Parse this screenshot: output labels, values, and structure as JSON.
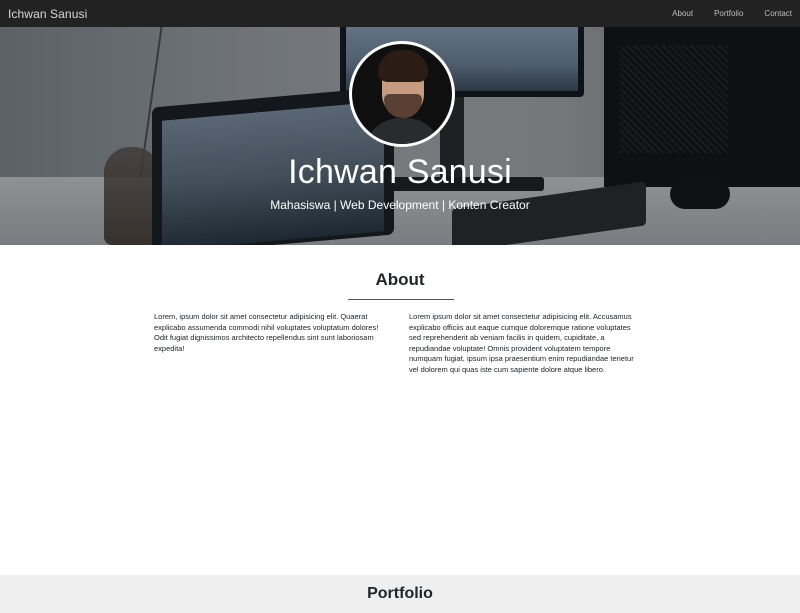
{
  "navbar": {
    "brand": "Ichwan Sanusi",
    "links": [
      "About",
      "Portfolio",
      "Contact"
    ]
  },
  "hero": {
    "name": "Ichwan Sanusi",
    "subtitle": "Mahasiswa | Web Development | Konten Creator"
  },
  "about": {
    "title": "About",
    "left_text": "Lorem, ipsum dolor sit amet consectetur adipisicing elit. Quaerat explicabo assumenda commodi nihil voluptates voluptatum dolores! Odit fugiat dignissimos architecto repellendus sint sunt laboriosam expedita!",
    "right_text": "Lorem ipsum dolor sit amet consectetur adipisicing elit. Accusamus explicabo officiis aut eaque cumque doloremque ratione voluptates sed reprehenderit ab veniam facilis in quidem, cupiditate, a repudiandae voluptate! Omnis provident voluptatem tempore numquam fugiat, ipsum ipsa praesentium enim repudiandae tenetur vel dolorem qui quas iste cum sapiente dolore atque libero."
  },
  "portfolio": {
    "title": "Portfolio"
  },
  "colors": {
    "navbar_bg": "#222222",
    "portfolio_bg": "#efefef"
  }
}
